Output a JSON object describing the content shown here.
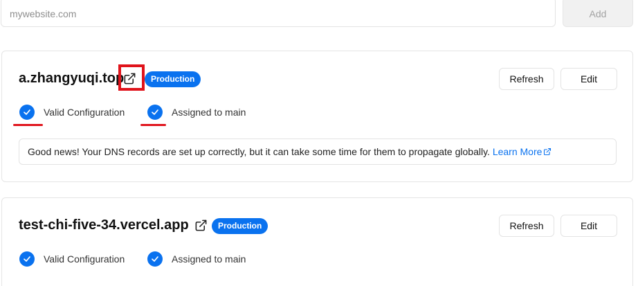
{
  "add_domain": {
    "placeholder": "mywebsite.com",
    "button_label": "Add"
  },
  "domains": [
    {
      "name": "a.zhangyuqi.top",
      "badge": "Production",
      "refresh_label": "Refresh",
      "edit_label": "Edit",
      "status_valid": "Valid Configuration",
      "status_assigned": "Assigned to main",
      "notice_text": "Good news! Your DNS records are set up correctly, but it can take some time for them to propagate globally.",
      "notice_link": "Learn More"
    },
    {
      "name": "test-chi-five-34.vercel.app",
      "badge": "Production",
      "refresh_label": "Refresh",
      "edit_label": "Edit",
      "status_valid": "Valid Configuration",
      "status_assigned": "Assigned to main"
    }
  ],
  "colors": {
    "accent": "#0a72ef",
    "annotation": "#e0131b",
    "border": "#e3e3e3"
  },
  "icons": {
    "external_link": "external-link-icon",
    "check": "check-circle-icon"
  }
}
